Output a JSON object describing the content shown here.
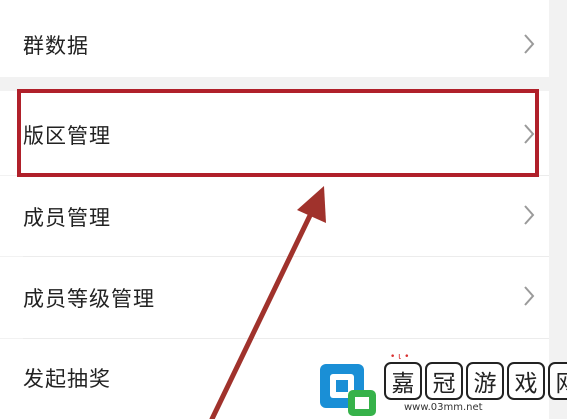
{
  "menu": {
    "items": [
      {
        "label": "群数据"
      },
      {
        "label": "版区管理"
      },
      {
        "label": "成员管理"
      },
      {
        "label": "成员等级管理"
      },
      {
        "label": "发起抽奖"
      }
    ]
  },
  "colors": {
    "highlight": "#b0202a",
    "arrow": "#a0322c",
    "background": "#f2f2f2",
    "chevron": "#9a9a9a"
  },
  "watermark": {
    "chars": [
      "嘉",
      "冠",
      "游",
      "戏",
      "网"
    ],
    "url": "www.03mm.net"
  }
}
